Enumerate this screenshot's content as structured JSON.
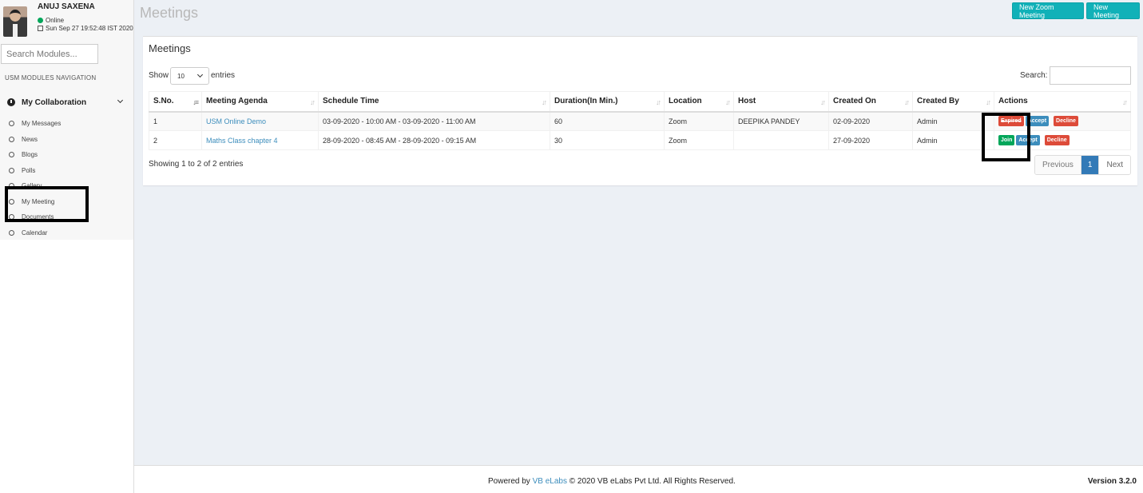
{
  "user": {
    "name": "ANUJ SAXENA",
    "status": "Online",
    "datetime": "Sun Sep 27 19:52:48 IST 2020"
  },
  "sidebar": {
    "search_placeholder": "Search Modules...",
    "nav_header": "USM MODULES NAVIGATION",
    "group_label": "My Collaboration",
    "items": [
      {
        "label": "My Messages"
      },
      {
        "label": "News"
      },
      {
        "label": "Blogs"
      },
      {
        "label": "Polls"
      },
      {
        "label": "Gallery"
      },
      {
        "label": "My Meeting"
      },
      {
        "label": "Documents"
      },
      {
        "label": "Calendar"
      }
    ]
  },
  "header": {
    "title": "Meetings",
    "new_zoom_label": "New Zoom Meeting",
    "new_meeting_label": "New Meeting"
  },
  "box": {
    "title": "Meetings",
    "show_label": "Show",
    "entries_value": "10",
    "entries_label": "entries",
    "search_label": "Search:",
    "columns": [
      "S.No.",
      "Meeting Agenda",
      "Schedule Time",
      "Duration(In Min.)",
      "Location",
      "Host",
      "Created On",
      "Created By",
      "Actions"
    ],
    "rows": [
      {
        "sno": "1",
        "agenda": "USM Online Demo",
        "schedule": "03-09-2020 - 10:00 AM - 03-09-2020 - 11:00 AM",
        "duration": "60",
        "location": "Zoom",
        "host": "DEEPIKA PANDEY",
        "created_on": "02-09-2020",
        "created_by": "Admin",
        "action1": "Expired",
        "action2": "Accept",
        "action3": "Decline"
      },
      {
        "sno": "2",
        "agenda": "Maths Class chapter 4",
        "schedule": "28-09-2020 - 08:45 AM - 28-09-2020 - 09:15 AM",
        "duration": "30",
        "location": "Zoom",
        "host": "",
        "created_on": "27-09-2020",
        "created_by": "Admin",
        "action1": "Join",
        "action2": "Accept",
        "action3": "Decline"
      }
    ],
    "info": "Showing 1 to 2 of 2 entries",
    "pager": {
      "previous": "Previous",
      "current": "1",
      "next": "Next"
    }
  },
  "footer": {
    "powered_by": "Powered by",
    "company_link": "VB eLabs",
    "copyright": "© 2020 VB eLabs Pvt Ltd. All Rights Reserved.",
    "version": "Version 3.2.0"
  },
  "colors": {
    "accent_teal": "#11b1b8",
    "link_blue": "#3c8dbc",
    "danger": "#dd4b39",
    "success": "#00a65a"
  }
}
